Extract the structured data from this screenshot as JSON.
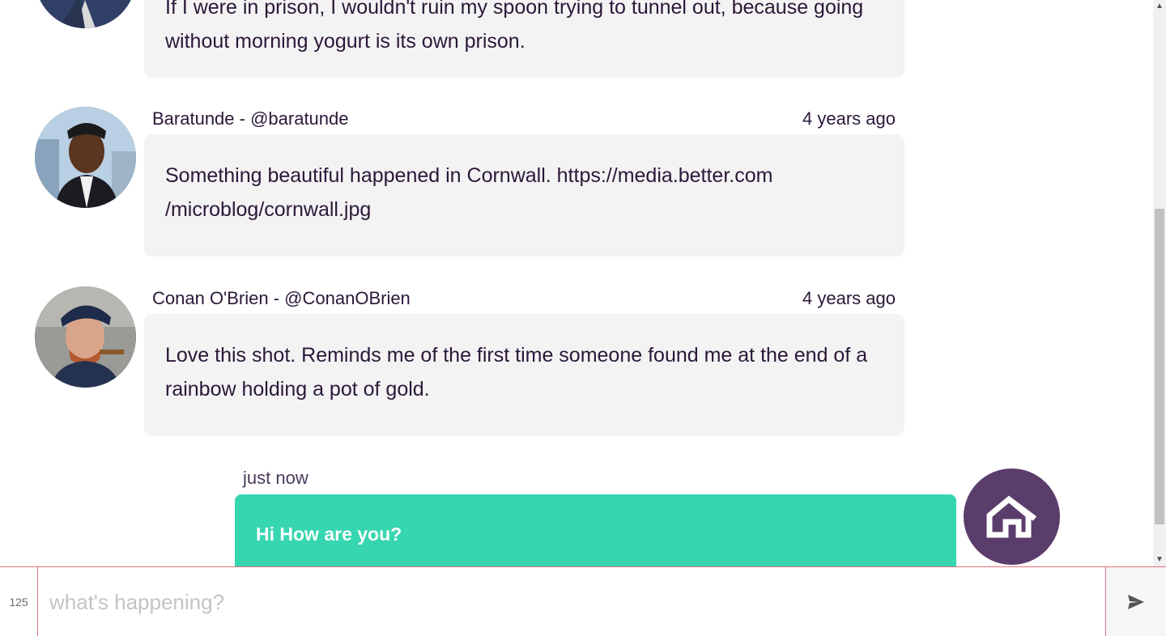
{
  "posts": [
    {
      "author": "",
      "time": "",
      "text": "If I were in prison, I wouldn't ruin my spoon trying to tunnel out, because going without morning yogurt is its own prison."
    },
    {
      "author": "Baratunde - @baratunde",
      "time": "4 years ago",
      "text": "Something beautiful happened in Cornwall. https://media.better.com /microblog/cornwall.jpg"
    },
    {
      "author": "Conan O'Brien - @ConanOBrien",
      "time": "4 years ago",
      "text": "Love this shot. Reminds me of the first time someone found me at the end of a rainbow holding a pot of gold."
    }
  ],
  "my_message": {
    "time": "just now",
    "text": "Hi How are you?"
  },
  "composer": {
    "counter": "125",
    "placeholder": "what's happening?"
  },
  "colors": {
    "my_bubble": "#35d6b0",
    "my_avatar": "#5b3d6b",
    "bubble_bg": "#f3f3f4",
    "input_border": "#e07080"
  },
  "icons": {
    "send": "send-icon",
    "brand": "house-logo-icon"
  }
}
